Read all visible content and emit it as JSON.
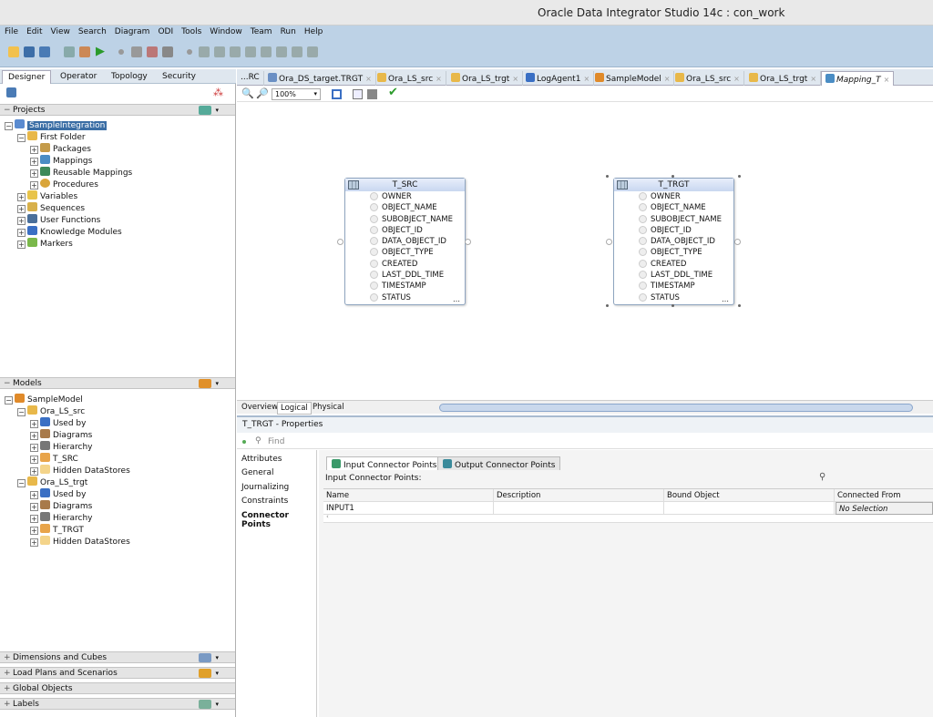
{
  "window": {
    "title": "Oracle Data Integrator Studio 14c : con_work"
  },
  "menu": [
    "File",
    "Edit",
    "View",
    "Search",
    "Diagram",
    "ODI",
    "Tools",
    "Window",
    "Team",
    "Run",
    "Help"
  ],
  "navigator": {
    "tabs": [
      "Designer",
      "Operator",
      "Topology",
      "Security"
    ],
    "active_tab": "Designer"
  },
  "projects": {
    "header": "Projects",
    "tree": [
      {
        "label": "SampleIntegration",
        "selected": true
      },
      {
        "label": "First Folder"
      },
      {
        "label": "Packages"
      },
      {
        "label": "Mappings"
      },
      {
        "label": "Reusable Mappings"
      },
      {
        "label": "Procedures"
      },
      {
        "label": "Variables"
      },
      {
        "label": "Sequences"
      },
      {
        "label": "User Functions"
      },
      {
        "label": "Knowledge Modules"
      },
      {
        "label": "Markers"
      }
    ]
  },
  "models": {
    "header": "Models",
    "tree": [
      {
        "label": "SampleModel"
      },
      {
        "label": "Ora_LS_src"
      },
      {
        "label": "Used by"
      },
      {
        "label": "Diagrams"
      },
      {
        "label": "Hierarchy"
      },
      {
        "label": "T_SRC"
      },
      {
        "label": "Hidden DataStores"
      },
      {
        "label": "Ora_LS_trgt"
      },
      {
        "label": "Used by"
      },
      {
        "label": "Diagrams"
      },
      {
        "label": "Hierarchy"
      },
      {
        "label": "T_TRGT"
      },
      {
        "label": "Hidden DataStores"
      }
    ]
  },
  "bottom_panes": [
    "Dimensions and Cubes",
    "Load Plans and Scenarios",
    "Global Objects",
    "Labels"
  ],
  "doc_tabs": [
    {
      "label": "...RC"
    },
    {
      "label": "Ora_DS_target.TRGT"
    },
    {
      "label": "Ora_LS_src"
    },
    {
      "label": "Ora_LS_trgt"
    },
    {
      "label": "LogAgent1"
    },
    {
      "label": "SampleModel"
    },
    {
      "label": "Ora_LS_src"
    },
    {
      "label": "Ora_LS_trgt"
    },
    {
      "label": "Mapping_T",
      "active": true
    }
  ],
  "editor": {
    "zoom": "100%",
    "view_tabs": [
      "Overview",
      "Logical",
      "Physical"
    ],
    "active_view": "Logical"
  },
  "datastores": [
    {
      "name": "T_SRC",
      "attributes": [
        "OWNER",
        "OBJECT_NAME",
        "SUBOBJECT_NAME",
        "OBJECT_ID",
        "DATA_OBJECT_ID",
        "OBJECT_TYPE",
        "CREATED",
        "LAST_DDL_TIME",
        "TIMESTAMP",
        "STATUS"
      ]
    },
    {
      "name": "T_TRGT",
      "attributes": [
        "OWNER",
        "OBJECT_NAME",
        "SUBOBJECT_NAME",
        "OBJECT_ID",
        "DATA_OBJECT_ID",
        "OBJECT_TYPE",
        "CREATED",
        "LAST_DDL_TIME",
        "TIMESTAMP",
        "STATUS"
      ]
    }
  ],
  "properties": {
    "title": "T_TRGT - Properties",
    "find_placeholder": "Find",
    "side_tabs": [
      "Attributes",
      "General",
      "Journalizing",
      "Constraints",
      "Connector Points"
    ],
    "active_side_tab": "Connector Points",
    "sub_tabs": [
      "Input Connector Points",
      "Output Connector Points"
    ],
    "active_sub_tab": "Input Connector Points",
    "section_label": "Input Connector Points:",
    "columns": [
      "Name",
      "Description",
      "Bound Object",
      "Connected From"
    ],
    "rows": [
      {
        "name": "INPUT1",
        "description": "",
        "bound_object": "",
        "connected_from": "No Selection"
      }
    ]
  },
  "colors": {
    "chrome": "#bdd2e6",
    "selection": "#3b6ea5"
  }
}
